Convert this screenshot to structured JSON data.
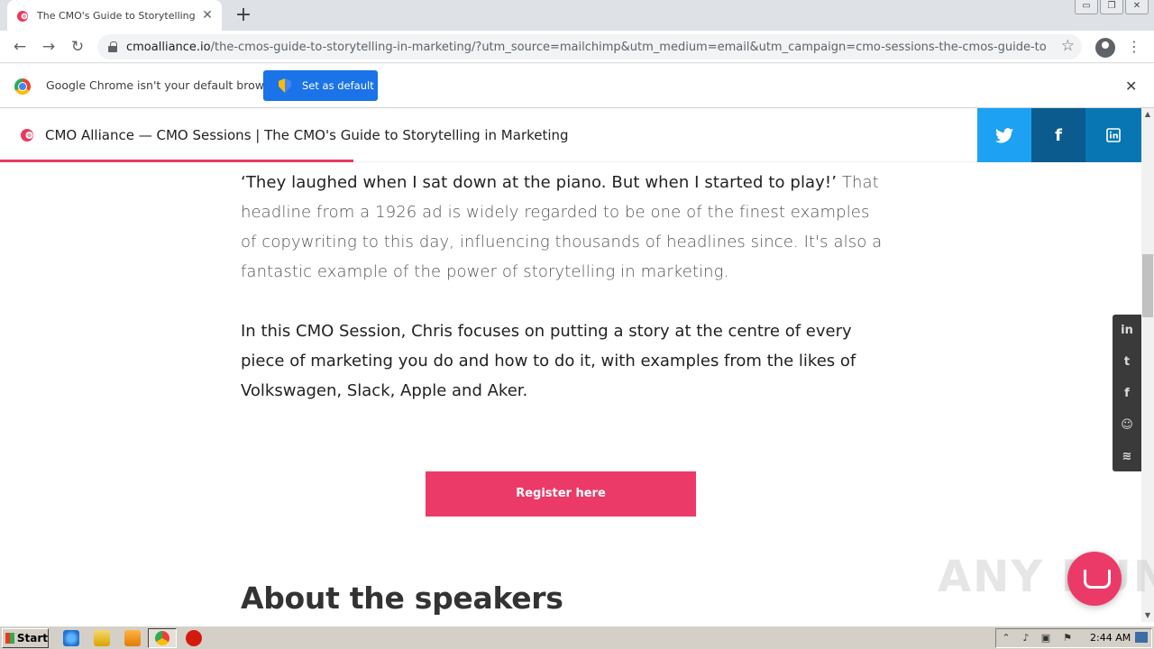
{
  "browser": {
    "tab_title": "The CMO's Guide to Storytelling in M",
    "tab_close": "✕",
    "new_tab": "+",
    "window_controls": [
      "▭",
      "❐",
      "✕"
    ],
    "url_host": "cmoalliance.io",
    "url_path": "/the-cmos-guide-to-storytelling-in-marketing/?utm_source=mailchimp&utm_medium=email&utm_campaign=cmo-sessions-the-cmos-guide-to-storytelli...",
    "back": "←",
    "forward": "→",
    "reload": "↻",
    "star": "☆",
    "menu": "⋮"
  },
  "infobar": {
    "message": "Google Chrome isn't your default browser",
    "button": "Set as default",
    "close": "✕"
  },
  "header": {
    "title_brand": "CMO Alliance — ",
    "title_article": "CMO Sessions | The CMO's Guide to Storytelling in Marketing",
    "share_twitter": "t",
    "share_facebook": "f",
    "share_linkedin": "in",
    "progress_fraction": 0.31,
    "colors": {
      "accent": "#e83a5e",
      "twitter": "#1da1f2",
      "facebook": "#0b5b8e",
      "linkedin": "#0976b4"
    }
  },
  "article": {
    "lead_quote": "‘They laughed when I sat down at the piano. But when I started to play!’",
    "paragraph1": "That headline from a 1926 ad is widely regarded to be one of the finest examples of copywriting to this day, influencing thousands of headlines since. It's also a fantastic example of the power of storytelling in marketing.",
    "paragraph2": "In this CMO Session, Chris focuses on putting a story at the centre of every piece of marketing you do and how to do it, with examples from the likes of Volkswagen, Slack, Apple and Aker.",
    "cta": "Register here",
    "section_heading": "About the speakers",
    "cta_color": "#ec3a68"
  },
  "floating_social": {
    "icons": [
      "linkedin-icon",
      "twitter-icon",
      "facebook-icon",
      "reddit-icon",
      "rss-icon"
    ],
    "glyphs": [
      "in",
      "t",
      "f",
      "☺",
      "≋"
    ]
  },
  "watermark": "ANY RUN",
  "taskbar": {
    "start": "Start",
    "clock": "2:44 AM"
  }
}
